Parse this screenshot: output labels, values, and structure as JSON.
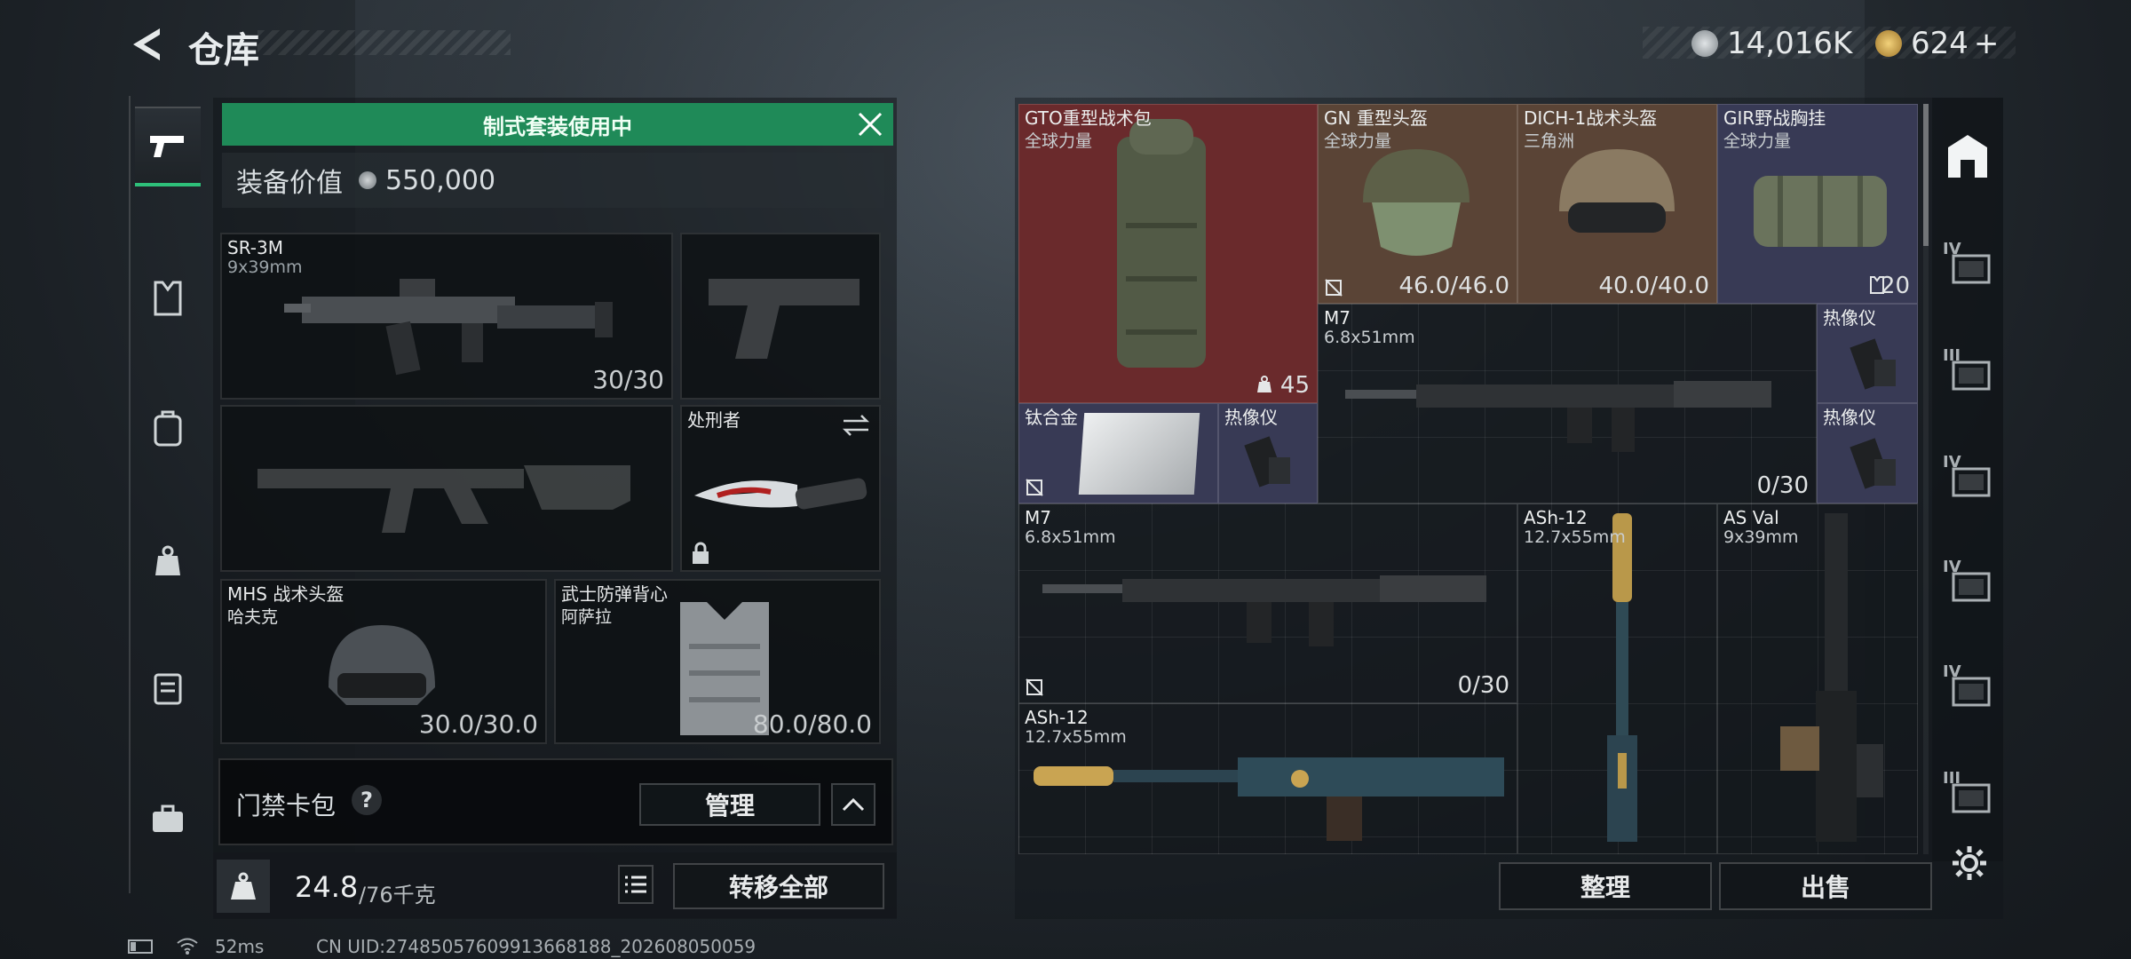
{
  "header": {
    "title": "仓库"
  },
  "currency": {
    "silver": "14,016K",
    "gold": "624",
    "gold_add": "+"
  },
  "banner": {
    "text": "制式套装使用中"
  },
  "equipment_value": {
    "label": "装备价值",
    "value": "550,000"
  },
  "left_slots": {
    "primary": {
      "name": "SR-3M",
      "ammo": "9x39mm",
      "count": "30/30"
    },
    "melee": {
      "name": "处刑者"
    },
    "helmet": {
      "name": "MHS 战术头盔",
      "origin": "哈夫克",
      "durability": "30.0/30.0"
    },
    "armor": {
      "name": "武士防弹背心",
      "origin": "阿萨拉",
      "durability": "80.0/80.0"
    }
  },
  "access_card": {
    "label": "门禁卡包",
    "help": "?",
    "manage": "管理"
  },
  "bottom": {
    "weight": "24.8",
    "weight_max": "/76千克",
    "transfer_all": "转移全部"
  },
  "grid": {
    "items": [
      {
        "name": "GTO重型战术包",
        "sub": "全球力量",
        "count": "45"
      },
      {
        "name": "GN 重型头盔",
        "sub": "全球力量",
        "count": "46.0/46.0"
      },
      {
        "name": "DICH-1战术头盔",
        "sub": "三角洲",
        "count": "40.0/40.0"
      },
      {
        "name": "GIR野战胸挂",
        "sub": "全球力量",
        "count": "20"
      },
      {
        "name": "M7",
        "sub": "6.8x51mm",
        "count": "0/30"
      },
      {
        "name": "热像仪"
      },
      {
        "name": "钛合金"
      },
      {
        "name": "热像仪"
      },
      {
        "name": "热像仪"
      },
      {
        "name": "M7",
        "sub": "6.8x51mm",
        "count": "0/30"
      },
      {
        "name": "ASh-12",
        "sub": "12.7x55mm"
      },
      {
        "name": "AS Val",
        "sub": "9x39mm"
      },
      {
        "name": "ASh-12",
        "sub": "12.7x55mm"
      }
    ]
  },
  "actions": {
    "sort": "整理",
    "sell": "出售"
  },
  "status": {
    "ping": "52ms",
    "uid": "CN UID:27485057609913668188_202608050059"
  },
  "right_tabs": [
    "IV",
    "III",
    "IV",
    "IV",
    "IV",
    "III"
  ],
  "colors": {
    "accent_green": "#1f8a58",
    "bag_red": "#6a2a2c",
    "helmet_brown": "#5a4436",
    "purple_slot": "#383a55"
  }
}
